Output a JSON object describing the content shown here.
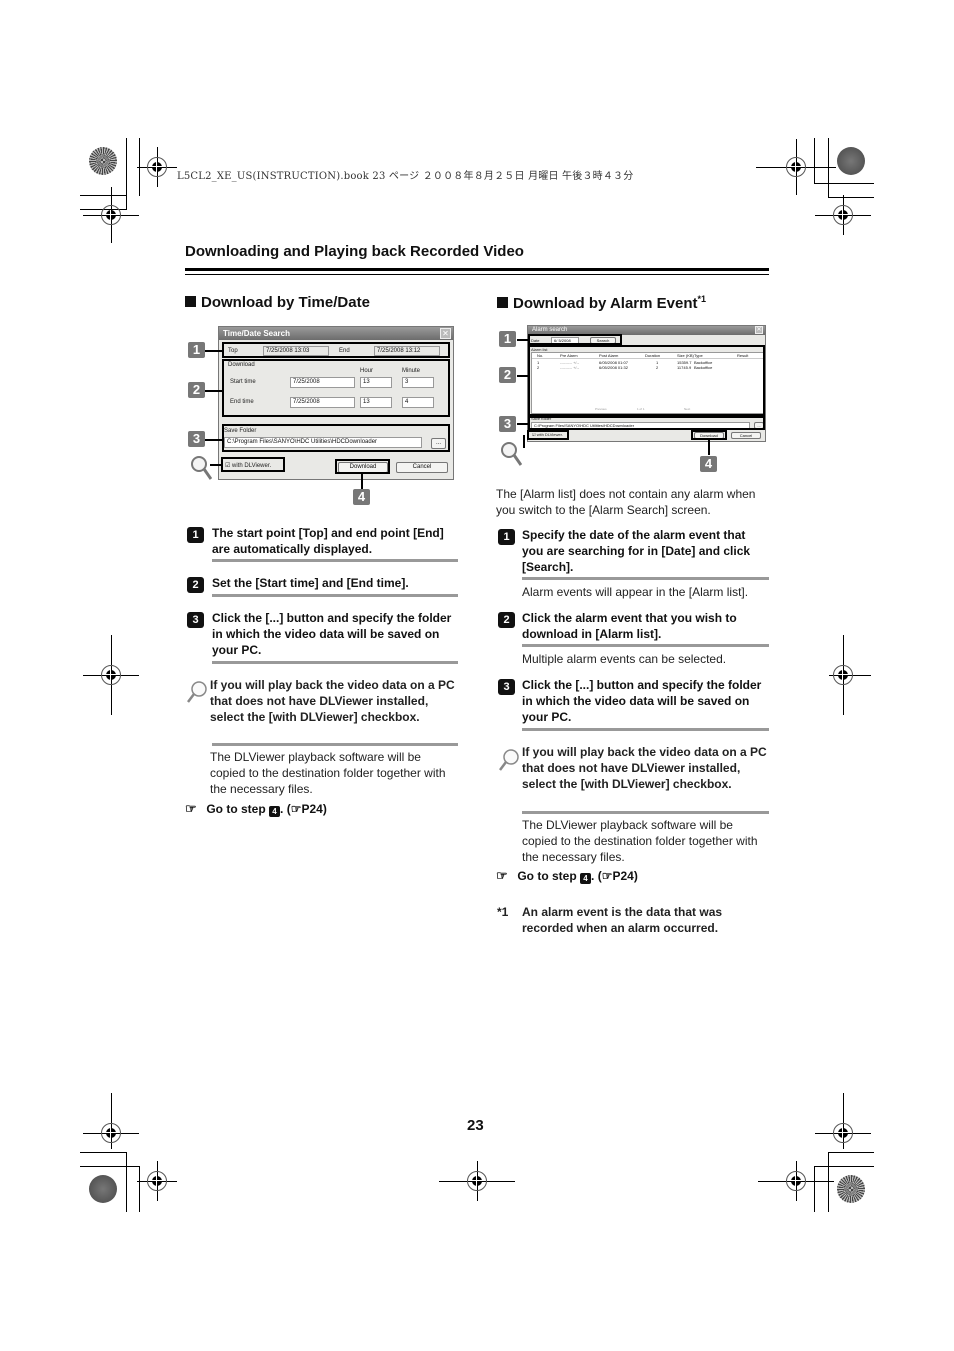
{
  "print_header": "L5CL2_XE_US(INSTRUCTION).book  23 ページ  ２００８年８月２５日  月曜日  午後３時４３分",
  "section_title": "Downloading and Playing back Recorded Video",
  "left": {
    "title": "Download by Time/Date",
    "dialog": {
      "title": "Time/Date Search",
      "top_label": "Top",
      "top_value": "7/25/2008 13:03",
      "end_label": "End",
      "end_value": "7/25/2008 13:12",
      "download_group": "Download",
      "hour_label": "Hour",
      "minute_label": "Minute",
      "start_label": "Start time",
      "start_date": "7/25/2008",
      "start_hour": "13",
      "start_minute": "3",
      "end_time_label": "End time",
      "end_date": "7/25/2008",
      "end_hour": "13",
      "end_minute": "4",
      "save_folder_label": "Save Folder",
      "save_folder_path": "C:\\Program Files\\SANYO\\HDC Utilities\\HDCDownloader",
      "browse_label": "...",
      "with_dlviewer_label": "with DLViewer.",
      "download_btn": "Download",
      "cancel_btn": "Cancel",
      "callouts": [
        "1",
        "2",
        "3",
        "4"
      ]
    },
    "steps": [
      {
        "num": "1",
        "text": "The start point [Top] and end point [End] are automatically displayed."
      },
      {
        "num": "2",
        "text": "Set the [Start time] and [End time]."
      },
      {
        "num": "3",
        "text": "Click the [...] button and specify the folder in which the video data will be saved on your PC."
      }
    ],
    "tip": "If you will play back the video data on a PC that does not have DLViewer installed, select the [with DLViewer] checkbox.",
    "tip_note": "The DLViewer playback software will be copied to the destination folder together with the necessary files.",
    "goto_prefix": "Go to step",
    "goto_step": "4",
    "goto_ref": "P24"
  },
  "right": {
    "title": "Download by Alarm Event",
    "title_sup": "*1",
    "dialog": {
      "title": "Alarm search",
      "date_label": "Date",
      "date_value": "6/ 5/2008",
      "search_btn": "Search",
      "alarm_list_label": "Alarm list",
      "columns": [
        "No.",
        "Pre Alarm",
        "Post Alarm",
        "Duration",
        "Size (KB)",
        "Type",
        "Result"
      ],
      "rows": [
        [
          "1",
          "--------- +/--",
          "6/05/2008 01:07",
          "1",
          "15359.7",
          "Backoffice",
          ""
        ],
        [
          "2",
          "--------- +/--",
          "6/05/2008 01:32",
          "2",
          "11745.9",
          "Backoffice",
          ""
        ]
      ],
      "pager": [
        "Previous",
        "1 of 1",
        "Next"
      ],
      "save_folder_label": "Save folder",
      "save_folder_path": "C:\\Program Files\\SANYO\\HDC Utilities\\HDCDownloader",
      "browse_label": "...",
      "with_dlviewer_label": "with DLViewer.",
      "download_btn": "Download",
      "cancel_btn": "Cancel",
      "callouts": [
        "1",
        "2",
        "3",
        "4"
      ]
    },
    "intro": "The [Alarm list] does not contain any alarm when you switch to the [Alarm Search] screen.",
    "steps": [
      {
        "num": "1",
        "text": "Specify the date of the alarm event that you are searching for in [Date] and click [Search].",
        "note": "Alarm events will appear in the [Alarm list]."
      },
      {
        "num": "2",
        "text": "Click the alarm event that you wish to download in [Alarm list].",
        "note": "Multiple alarm events can be selected."
      },
      {
        "num": "3",
        "text": "Click the [...] button and specify the folder in which the video data will be saved on your PC."
      }
    ],
    "tip": "If you will play back the video data on a PC that does not have DLViewer installed, select the [with DLViewer] checkbox.",
    "tip_note": "The DLViewer playback software will be copied to the destination folder together with the necessary files.",
    "goto_prefix": "Go to step",
    "goto_step": "4",
    "goto_ref": "P24",
    "footnote_mark": "*1",
    "footnote": "An alarm event is the data that was recorded when an alarm occurred."
  },
  "page_number": "23"
}
